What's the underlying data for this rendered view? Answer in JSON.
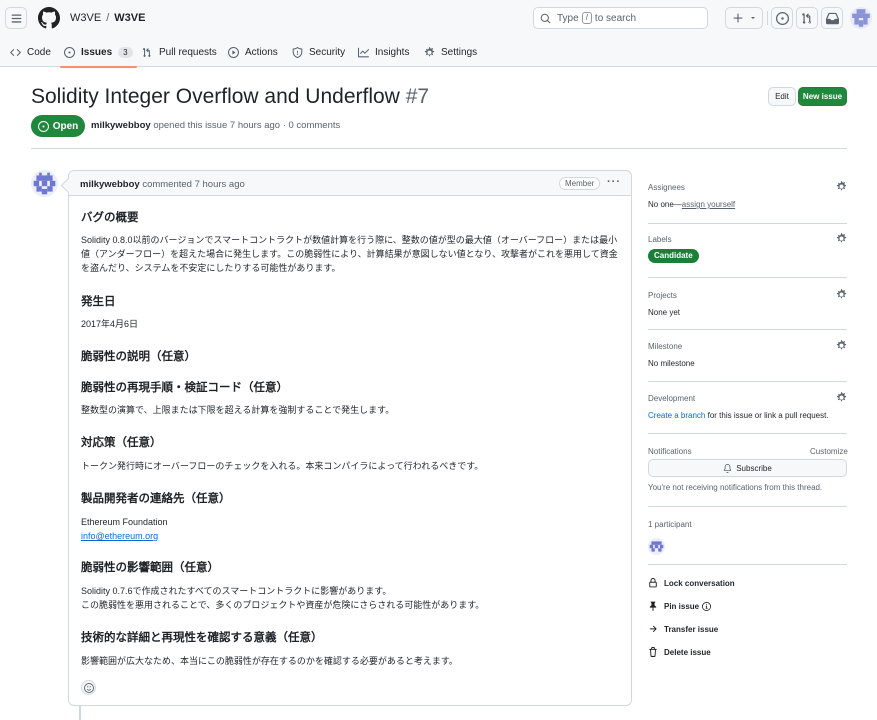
{
  "header": {
    "owner": "W3VE",
    "separator": "/",
    "repo": "W3VE",
    "search_prefix": "Type",
    "search_key": "/",
    "search_suffix": "to search"
  },
  "tabs": [
    {
      "label": "Code"
    },
    {
      "label": "Issues",
      "count": "3"
    },
    {
      "label": "Pull requests"
    },
    {
      "label": "Actions"
    },
    {
      "label": "Security"
    },
    {
      "label": "Insights"
    },
    {
      "label": "Settings"
    }
  ],
  "issue": {
    "title": "Solidity Integer Overflow and Underflow",
    "number": "#7",
    "edit_label": "Edit",
    "new_label": "New issue",
    "state": "Open",
    "author": "milkywebboy",
    "meta_text": "opened this issue 7 hours ago · 0 comments"
  },
  "comment": {
    "author": "milkywebboy",
    "time_text": "commented 7 hours ago",
    "role": "Member",
    "dots": "···",
    "h1": "バグの概要",
    "p1": "Solidity 0.8.0以前のバージョンでスマートコントラクトが数値計算を行う際に、整数の値が型の最大値（オーバーフロー）または最小値（アンダーフロー）を超えた場合に発生します。この脆弱性により、計算結果が意図しない値となり、攻撃者がこれを悪用して資金を盗んだり、システムを不安定にしたりする可能性があります。",
    "h2": "発生日",
    "p2": "2017年4月6日",
    "h3": "脆弱性の説明（任意）",
    "h4": "脆弱性の再現手順・検証コード（任意）",
    "p4": "整数型の演算で、上限または下限を超える計算を強制することで発生します。",
    "h5": "対応策（任意）",
    "p5": "トークン発行時にオーバーフローのチェックを入れる。本来コンパイラによって行われるべきです。",
    "h6": "製品開発者の連絡先（任意）",
    "p6a": "Ethereum Foundation",
    "p6b": "info@ethereum.org",
    "h7": "脆弱性の影響範囲（任意）",
    "p7a": "Solidity 0.7.6で作成されたすべてのスマートコントラクトに影響があります。",
    "p7b": "この脆弱性を悪用されることで、多くのプロジェクトや資産が危険にさらされる可能性があります。",
    "h8": "技術的な詳細と再現性を確認する意義（任意）",
    "p8": "影響範囲が広大なため、本当にこの脆弱性が存在するのかを確認する必要があると考えます。"
  },
  "sidebar": {
    "assignees_label": "Assignees",
    "assignees_none": "No one—",
    "assignees_link": "assign yourself",
    "labels_label": "Labels",
    "label_candidate": "Candidate",
    "projects_label": "Projects",
    "projects_value": "None yet",
    "milestone_label": "Milestone",
    "milestone_value": "No milestone",
    "development_label": "Development",
    "development_link": "Create a branch",
    "development_text": "for this issue or link a pull request.",
    "notifications_label": "Notifications",
    "customize": "Customize",
    "subscribe": "Subscribe",
    "notifications_note": "You're not receiving notifications from this thread.",
    "participants": "1 participant",
    "actions": [
      "Lock conversation",
      "Pin issue",
      "Transfer issue",
      "Delete issue"
    ]
  },
  "colors": {
    "open_green": "#1f883d",
    "label_green": "#1a7f37",
    "link_blue": "#0969da",
    "tab_underline": "#fd8c73"
  }
}
